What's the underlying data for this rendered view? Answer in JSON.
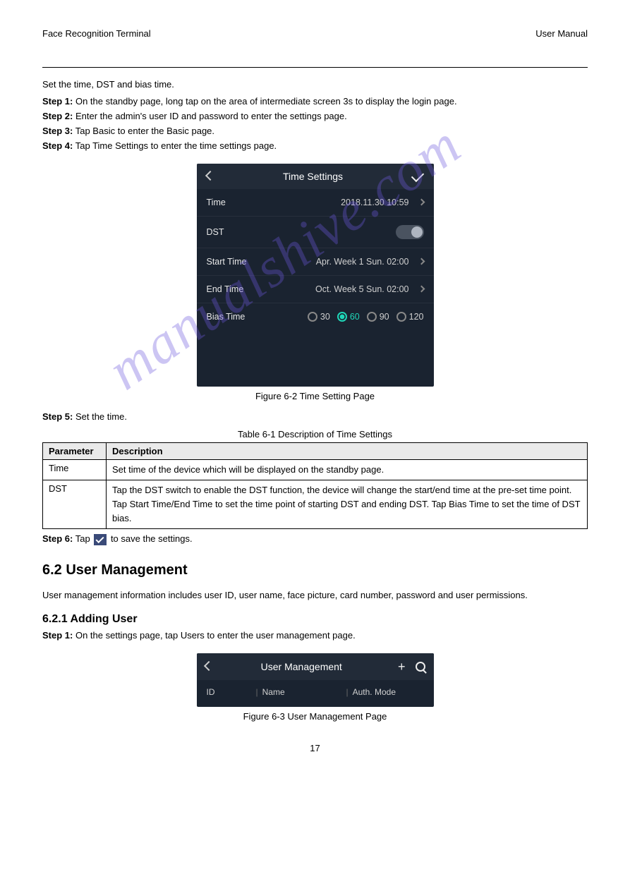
{
  "header": {
    "left": "Face Recognition Terminal",
    "right": "User Manual"
  },
  "intro_text": "Set the time, DST and bias time.",
  "steps": {
    "s1_label": "Step 1:",
    "s1_text": "On the standby page, long tap on the area of intermediate screen 3s to display the login page.",
    "s2_label": "Step 2:",
    "s2_text": "Enter the admin's user ID and password to enter the settings page.",
    "s3_label": "Step 3:",
    "s3_text": "Tap Basic to enter the Basic page.",
    "s4_label": "Step 4:",
    "s4_text": "Tap Time Settings to enter the time settings page.",
    "s5_label": "Step 5:",
    "s5_text": "Set the time.",
    "s6_label": "Step 6:",
    "s6_text_before": "Tap ",
    "s6_text_after": " to save the settings."
  },
  "figure1": {
    "title": "Time Settings",
    "rows": {
      "time_label": "Time",
      "time_value": "2018.11.30 10:59",
      "dst_label": "DST",
      "start_label": "Start Time",
      "start_value": "Apr.  Week 1   Sun.   02:00",
      "end_label": "End Time",
      "end_value": "Oct.  Week 5   Sun.   02:00",
      "bias_label": "Bias Time",
      "bias_options": [
        "30",
        "60",
        "90",
        "120"
      ],
      "bias_selected": "60"
    },
    "caption": "Figure 6-2 Time Setting Page"
  },
  "table": {
    "caption": "Table 6-1 Description of Time Settings",
    "headers": [
      "Parameter",
      "Description"
    ],
    "rows": [
      {
        "param": "Time",
        "desc": "Set time of the device which will be displayed on the standby page."
      },
      {
        "param": "DST",
        "desc": "Tap the DST switch to enable the DST function, the device will change the start/end time at the pre-set time point. Tap Start Time/End Time to set the time point of starting DST and ending DST. Tap Bias Time to set the time of DST bias."
      }
    ]
  },
  "section62": {
    "title": "6.2 User Management",
    "intro": "User management information includes user ID, user name, face picture, card number, password and user permissions.",
    "sub": "6.2.1 Adding User",
    "step1_label": "Step 1:",
    "step1_text": "On the settings page, tap Users to enter the user management page."
  },
  "figure2": {
    "title": "User Management",
    "cols": {
      "id": "ID",
      "name": "Name",
      "auth": "Auth. Mode"
    },
    "caption": "Figure 6-3 User Management Page"
  },
  "footer_page": "17"
}
